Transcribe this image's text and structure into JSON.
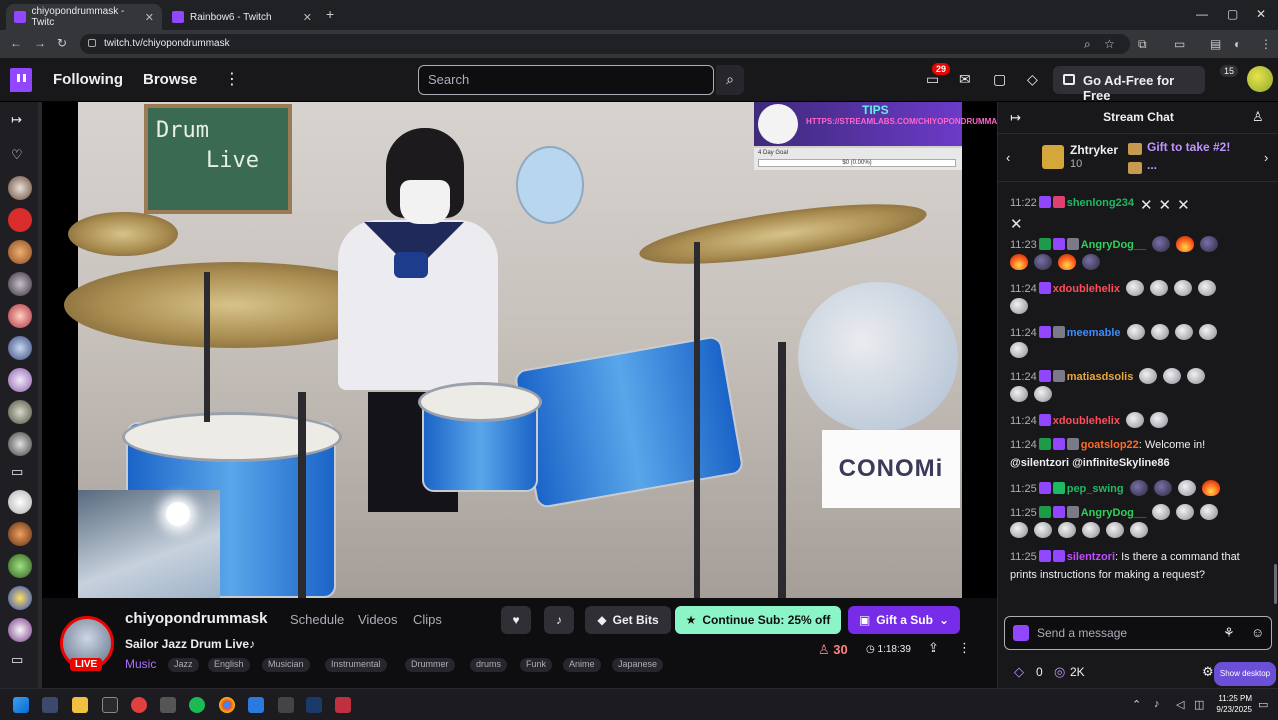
{
  "browser": {
    "tabs": [
      {
        "label": "chiyopondrummask - Twitc",
        "active": true
      },
      {
        "label": "Rainbow6 - Twitch",
        "active": false
      }
    ],
    "url": "twitch.tv/chiyopondrummask"
  },
  "nav": {
    "following": "Following",
    "browse": "Browse",
    "search_placeholder": "Search",
    "notif_count": "29",
    "ad_free": "Go Ad-Free for Free",
    "bits_count": "15"
  },
  "overlay": {
    "chalkboard_line1": "Drum",
    "chalkboard_line2": "Live",
    "tips_title": "TIPS",
    "tips_url": "HTTPS://STREAMLABS.COM/CHIYOPONDRUMMASK/TIP",
    "goal_label": "4 Day Goal",
    "goal_value": "$0 (0.00%)",
    "sponsor": "CONOMi"
  },
  "channel": {
    "name": "chiyopondrummask",
    "tabs": [
      "Schedule",
      "Videos",
      "Clips"
    ],
    "live": "LIVE",
    "title": "Sailor Jazz Drum Live♪",
    "category": "Music",
    "tags": [
      "Jazz",
      "English",
      "Musician",
      "Instrumental",
      "Drummer",
      "drums",
      "Funk",
      "Anime",
      "Japanese"
    ],
    "get_bits": "Get Bits",
    "continue_sub": "Continue Sub: 25% off",
    "gift_sub": "Gift a Sub",
    "viewers": "30",
    "uptime": "1:18:39"
  },
  "chat": {
    "title": "Stream Chat",
    "gift_user": "Zhtryker",
    "gift_count": "10",
    "gift_text": "Gift to take #2!",
    "gift_more": "...",
    "messages": [
      {
        "time": "11:22",
        "user": "shenlong234",
        "color": "#1fb864",
        "badges": [
          "sub"
        ],
        "text": ""
      },
      {
        "time": "11:23",
        "user": "AngryDog__",
        "color": "#2fd15c",
        "badges": [
          "mod",
          "sub",
          "vip"
        ],
        "text": ""
      },
      {
        "time": "11:24",
        "user": "xdoublehelix",
        "color": "#ff4d5a",
        "badges": [
          "sub"
        ],
        "text": ""
      },
      {
        "time": "11:24",
        "user": "meemable",
        "color": "#3d8bff",
        "badges": [
          "sub"
        ],
        "text": ""
      },
      {
        "time": "11:24",
        "user": "matiasdsolis",
        "color": "#e8a63a",
        "badges": [
          "sub",
          "vip"
        ],
        "text": ""
      },
      {
        "time": "11:24",
        "user": "xdoublehelix",
        "color": "#ff4d5a",
        "badges": [
          "sub"
        ],
        "text": ""
      },
      {
        "time": "11:24",
        "user": "goatslop22",
        "color": "#ff6a2a",
        "badges": [
          "mod",
          "sub"
        ],
        "text": ": Welcome in!"
      },
      {
        "time": "11:25",
        "user": "pep_swing",
        "color": "#1fb864",
        "badges": [
          "sub"
        ],
        "text": ""
      },
      {
        "time": "11:25",
        "user": "AngryDog__",
        "color": "#2fd15c",
        "badges": [
          "mod",
          "sub",
          "vip"
        ],
        "text": ""
      },
      {
        "time": "11:25",
        "user": "silentzori",
        "color": "#c04cff",
        "badges": [
          "sub",
          "sub"
        ],
        "text": ": Is there a command that prints instructions for making a request?"
      }
    ],
    "mention_line": "@silentzori @infiniteSkyline86",
    "input_placeholder": "Send a message",
    "points": "0",
    "points2": "2K",
    "show_desktop": "Show desktop"
  },
  "taskbar": {
    "time": "11:25 PM",
    "date": "9/23/2025"
  },
  "colors": {
    "twitch_purple": "#9146ff",
    "live_red": "#eb0400",
    "sub_green": "#8bf5c7"
  }
}
